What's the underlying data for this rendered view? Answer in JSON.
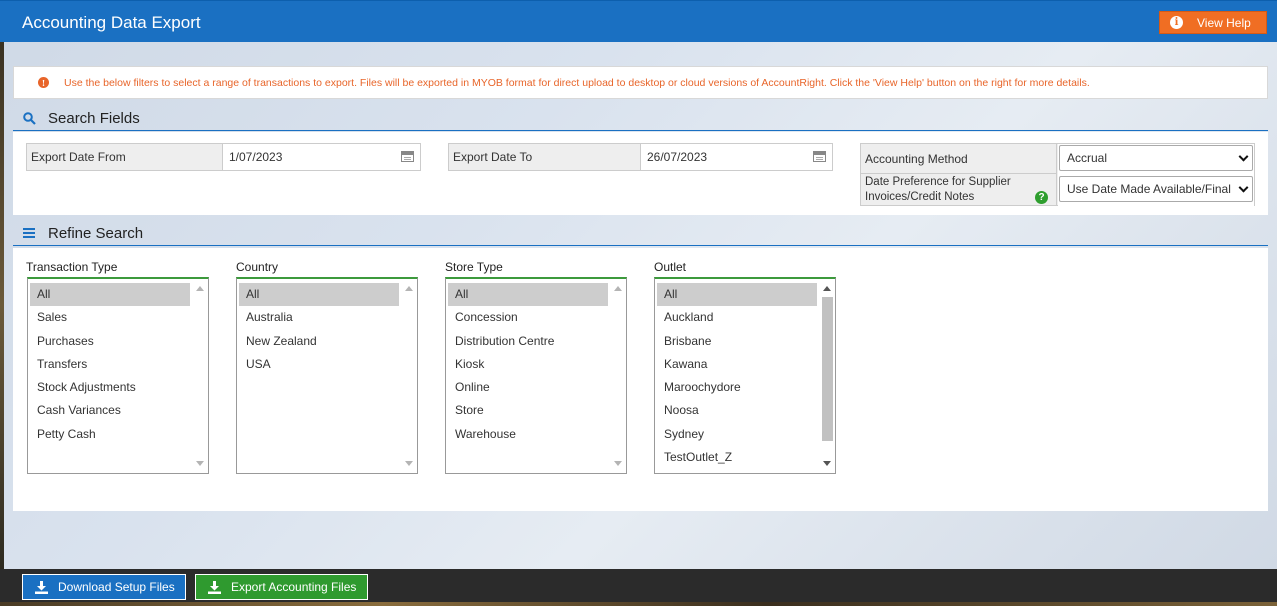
{
  "header": {
    "title": "Accounting Data Export",
    "help_label": "View Help",
    "help_icon": "info-icon"
  },
  "notice": {
    "text": "Use the below filters to select a range of transactions to export. Files will be exported in MYOB format for direct upload to desktop or cloud versions of AccountRight. Click the 'View Help' button on the right for more details.",
    "icon": "info-icon",
    "color": "#e8652a"
  },
  "search": {
    "heading": "Search Fields",
    "icon": "search-icon",
    "date_from_label": "Export Date From",
    "date_from_value": "1/07/2023",
    "date_to_label": "Export Date To",
    "date_to_value": "26/07/2023",
    "method_label": "Accounting Method",
    "method_value": "Accrual",
    "date_pref_label": "Date Preference for Supplier Invoices/Credit Notes",
    "date_pref_value": "Use Date Made Available/Final"
  },
  "refine": {
    "heading": "Refine Search",
    "icon": "list-icon",
    "transaction_type": {
      "label": "Transaction Type",
      "items": [
        "All",
        "Sales",
        "Purchases",
        "Transfers",
        "Stock Adjustments",
        "Cash Variances",
        "Petty Cash"
      ],
      "selected": "All"
    },
    "country": {
      "label": "Country",
      "items": [
        "All",
        "Australia",
        "New Zealand",
        "USA"
      ],
      "selected": "All"
    },
    "store_type": {
      "label": "Store Type",
      "items": [
        "All",
        "Concession",
        "Distribution Centre",
        "Kiosk",
        "Online",
        "Store",
        "Warehouse"
      ],
      "selected": "All"
    },
    "outlet": {
      "label": "Outlet",
      "items": [
        "All",
        "Auckland",
        "Brisbane",
        "Kawana",
        "Maroochydore",
        "Noosa",
        "Sydney",
        "TestOutlet_Z"
      ],
      "selected": "All"
    }
  },
  "footer": {
    "download_label": "Download Setup Files",
    "export_label": "Export Accounting Files",
    "download_color": "#1a70c2",
    "export_color": "#2f9a2f"
  }
}
